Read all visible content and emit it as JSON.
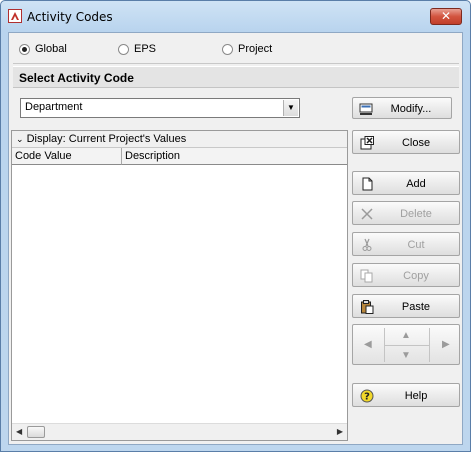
{
  "window": {
    "title": "Activity Codes",
    "close_glyph": "✕"
  },
  "scope": {
    "options": [
      {
        "label": "Global",
        "selected": true
      },
      {
        "label": "EPS",
        "selected": false
      },
      {
        "label": "Project",
        "selected": false
      }
    ]
  },
  "section": {
    "title": "Select Activity Code"
  },
  "code_select": {
    "value": "Department"
  },
  "buttons": {
    "modify": "Modify...",
    "close": "Close",
    "add": "Add",
    "delete": "Delete",
    "cut": "Cut",
    "copy": "Copy",
    "paste": "Paste",
    "help": "Help"
  },
  "grid": {
    "display_label": "Display: Current Project's Values",
    "columns": [
      "Code Value",
      "Description"
    ],
    "rows": []
  },
  "icons": {
    "app": "primavera-icon",
    "modify": "modify-icon",
    "close": "close-window-icon",
    "add": "new-document-icon",
    "delete": "delete-x-icon",
    "cut": "scissors-icon",
    "copy": "copy-icon",
    "paste": "clipboard-icon",
    "help": "help-icon"
  },
  "colors": {
    "titlebar": "#bdd6ee",
    "close_button": "#c9472f",
    "disabled_text": "#a0a0a0"
  }
}
